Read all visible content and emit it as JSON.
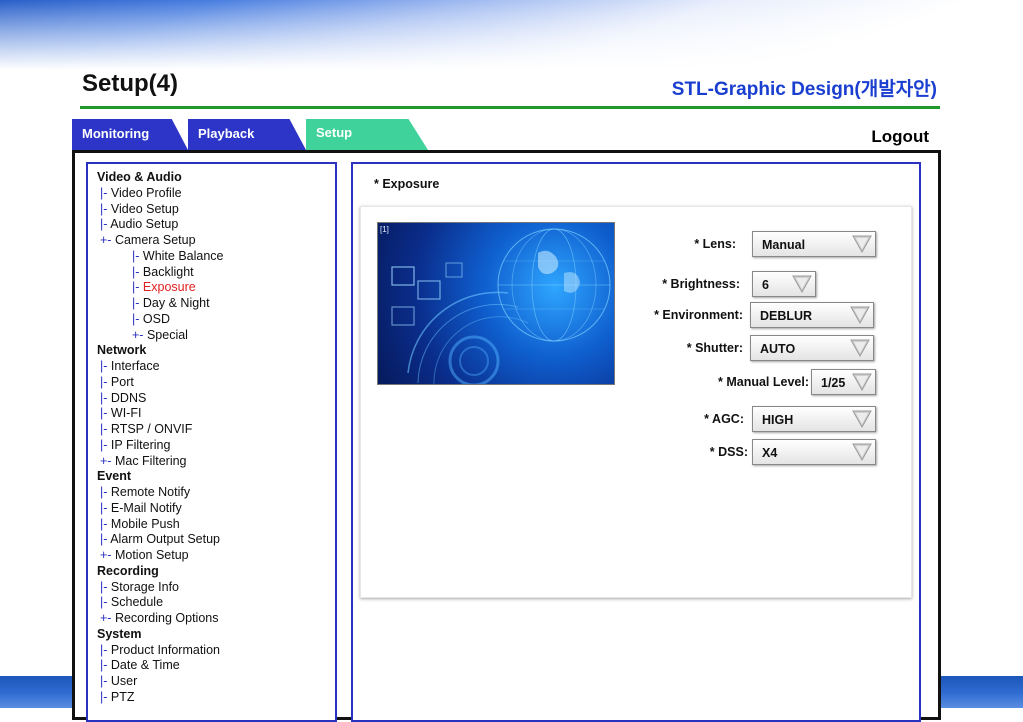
{
  "header": {
    "page_title": "Setup(4)",
    "design_title": "STL-Graphic Design(개발자안)"
  },
  "tabs": [
    {
      "label": "Monitoring",
      "active": false
    },
    {
      "label": "Playback",
      "active": false
    },
    {
      "label": "Setup",
      "active": true
    }
  ],
  "logout_label": "Logout",
  "colors": {
    "tab_inactive": "#2d35c8",
    "tab_active": "#3fd29a",
    "accent_green": "#1f9a2a",
    "active_menu_text": "#e02020",
    "title_blue": "#1a3fd0"
  },
  "sidebar": {
    "items": [
      {
        "prefix": "",
        "label": "Video & Audio",
        "section": true,
        "indent": 0
      },
      {
        "prefix": "|-",
        "label": "Video Profile",
        "indent": 1
      },
      {
        "prefix": "|-",
        "label": "Video Setup",
        "indent": 1
      },
      {
        "prefix": "|-",
        "label": "Audio Setup",
        "indent": 1
      },
      {
        "prefix": "+-",
        "label": "Camera Setup",
        "indent": 1
      },
      {
        "prefix": "|-",
        "label": "White Balance",
        "indent": 2
      },
      {
        "prefix": "|-",
        "label": "Backlight",
        "indent": 2
      },
      {
        "prefix": "|-",
        "label": "Exposure",
        "indent": 2,
        "active": true
      },
      {
        "prefix": "|-",
        "label": "Day & Night",
        "indent": 2
      },
      {
        "prefix": "|-",
        "label": "OSD",
        "indent": 2
      },
      {
        "prefix": "+-",
        "label": "Special",
        "indent": 2
      },
      {
        "prefix": "",
        "label": "Network",
        "section": true,
        "indent": 0
      },
      {
        "prefix": "|-",
        "label": "Interface",
        "indent": 1
      },
      {
        "prefix": "|-",
        "label": "Port",
        "indent": 1
      },
      {
        "prefix": "|-",
        "label": "DDNS",
        "indent": 1
      },
      {
        "prefix": "|-",
        "label": "WI-FI",
        "indent": 1
      },
      {
        "prefix": "|-",
        "label": "RTSP / ONVIF",
        "indent": 1
      },
      {
        "prefix": "|-",
        "label": "IP Filtering",
        "indent": 1
      },
      {
        "prefix": "+-",
        "label": "Mac Filtering",
        "indent": 1
      },
      {
        "prefix": "",
        "label": "Event",
        "section": true,
        "indent": 0
      },
      {
        "prefix": "|-",
        "label": "Remote Notify",
        "indent": 1
      },
      {
        "prefix": "|-",
        "label": "E-Mail Notify",
        "indent": 1
      },
      {
        "prefix": "|-",
        "label": "Mobile Push",
        "indent": 1
      },
      {
        "prefix": "|-",
        "label": "Alarm Output Setup",
        "indent": 1
      },
      {
        "prefix": "+-",
        "label": "Motion Setup",
        "indent": 1
      },
      {
        "prefix": "",
        "label": "Recording",
        "section": true,
        "indent": 0
      },
      {
        "prefix": "|-",
        "label": "Storage Info",
        "indent": 1
      },
      {
        "prefix": "|-",
        "label": "Schedule",
        "indent": 1
      },
      {
        "prefix": "+-",
        "label": "Recording Options",
        "indent": 1
      },
      {
        "prefix": "",
        "label": "System",
        "section": true,
        "indent": 0
      },
      {
        "prefix": "|-",
        "label": "Product Information",
        "indent": 1
      },
      {
        "prefix": "|-",
        "label": "Date & Time",
        "indent": 1
      },
      {
        "prefix": "|-",
        "label": "User",
        "indent": 1
      },
      {
        "prefix": "|-",
        "label": "PTZ",
        "indent": 1
      }
    ]
  },
  "exposure": {
    "heading": "*  Exposure",
    "preview_tag": "[1]",
    "fields": [
      {
        "label": "*  Lens:",
        "value": "Manual"
      },
      {
        "label": "*  Brightness:",
        "value": "6"
      },
      {
        "label": "*  Environment:",
        "value": "DEBLUR"
      },
      {
        "label": "*  Shutter:",
        "value": "AUTO"
      },
      {
        "label": "* Manual Level:",
        "value": "1/25"
      },
      {
        "label": "*  AGC:",
        "value": "HIGH"
      },
      {
        "label": "*  DSS:",
        "value": "X4"
      }
    ]
  },
  "icons": {
    "dropdown": "chevron-down-icon"
  }
}
